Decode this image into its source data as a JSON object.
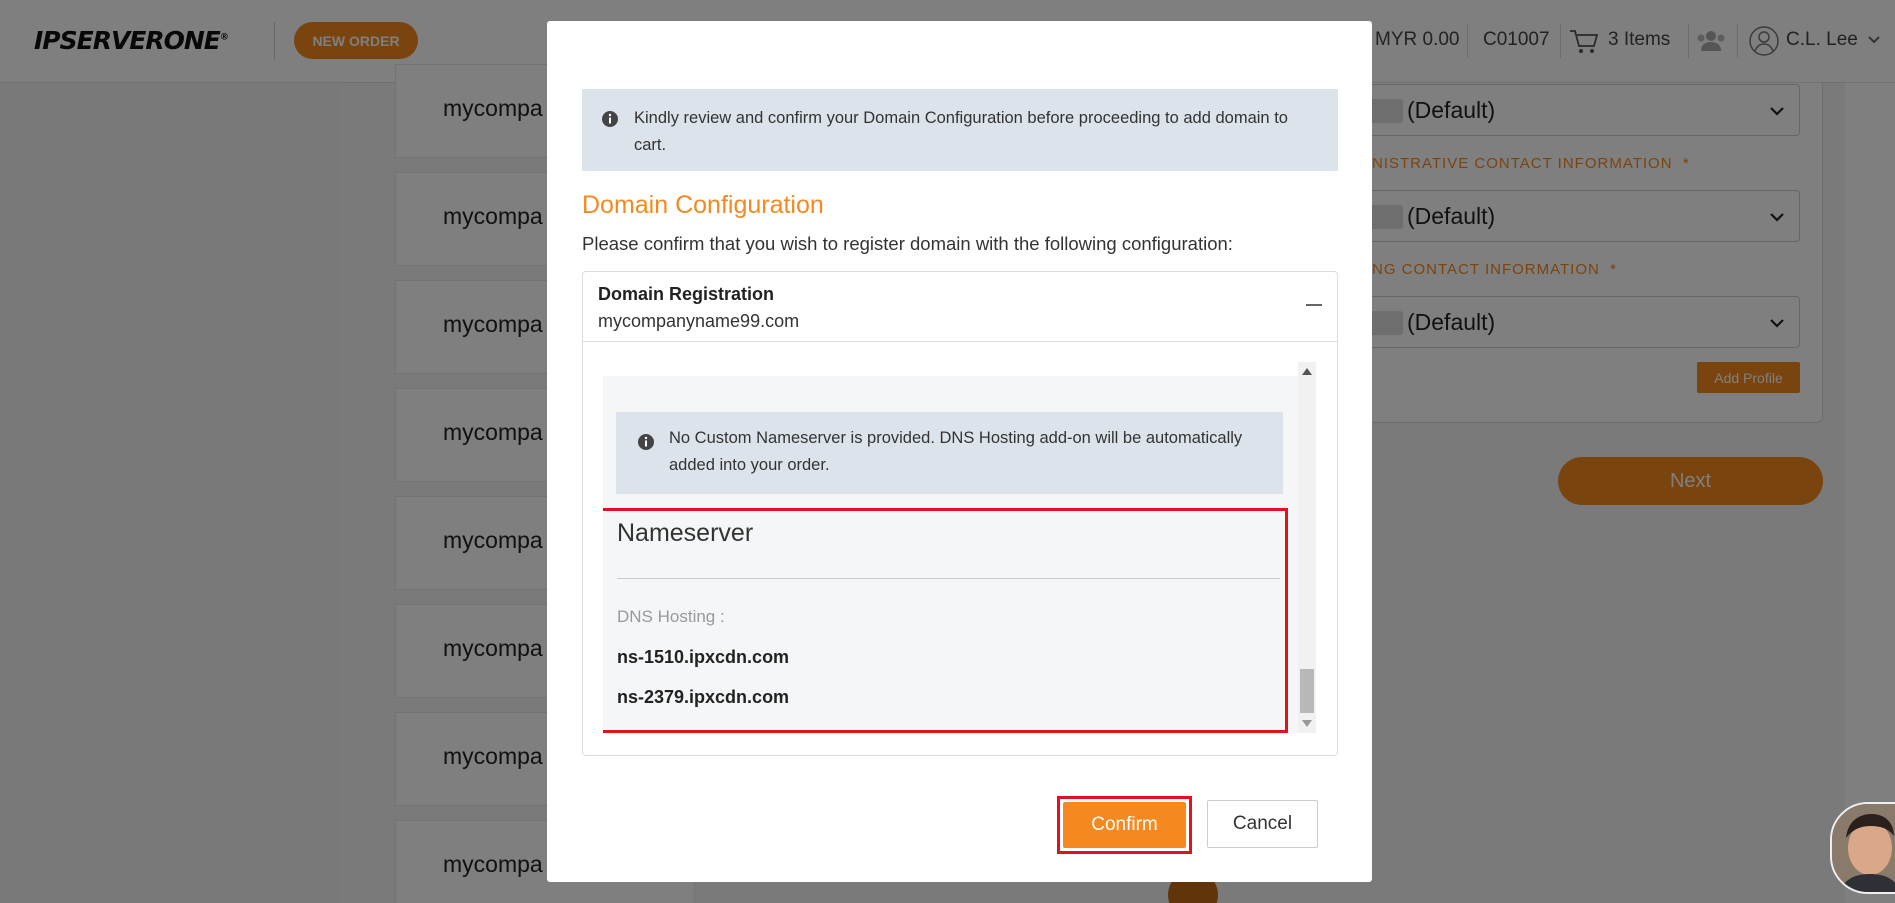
{
  "topbar": {
    "logo": "IPSERVERONE",
    "logo_mark": "®",
    "new_order": "NEW ORDER",
    "balance": "MYR 0.00",
    "account_id": "C01007",
    "cart_label": "3 Items",
    "user_name": "C.L. Lee"
  },
  "background": {
    "domain_cards": [
      "mycompa",
      "mycompa",
      "mycompa",
      "mycompa",
      "mycompa",
      "mycompa",
      "mycompa",
      "mycompa"
    ],
    "selects": [
      "(Default)",
      "(Default)",
      "(Default)"
    ],
    "admin_contact_label": "NISTRATIVE CONTACT INFORMATION",
    "billing_contact_label": "NG CONTACT INFORMATION",
    "required_mark": "*",
    "add_profile": "Add Profile",
    "next": "Next"
  },
  "modal": {
    "info_text": "Kindly review and confirm your Domain Configuration before proceeding to add domain to cart.",
    "section_title": "Domain Configuration",
    "section_subtitle": "Please confirm that you wish to register domain with the following configuration:",
    "registration": {
      "title": "Domain Registration",
      "domain": "mycompanyname99.com"
    },
    "nameserver_notice": "No Custom Nameserver is provided. DNS Hosting add-on will be automatically added into your order.",
    "nameserver": {
      "title": "Nameserver",
      "label": "DNS Hosting :",
      "servers": [
        "ns-1510.ipxcdn.com",
        "ns-2379.ipxcdn.com"
      ]
    },
    "confirm": "Confirm",
    "cancel": "Cancel"
  },
  "colors": {
    "accent": "#f5891f",
    "highlight": "#e3101e",
    "info_bg": "#dde3eb"
  }
}
